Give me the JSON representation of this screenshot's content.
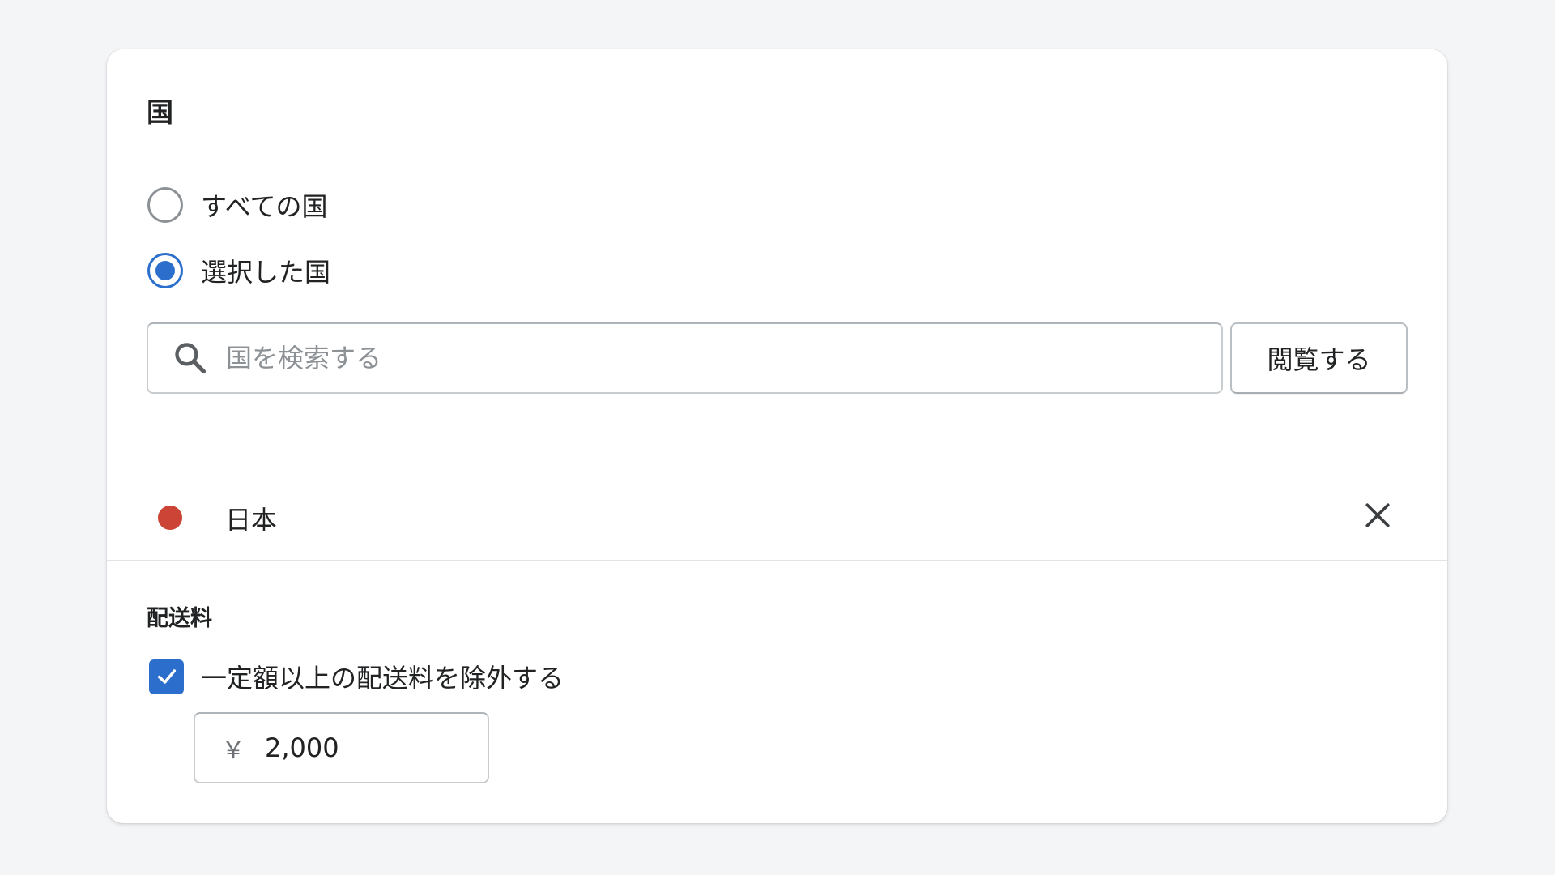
{
  "countries_section": {
    "title": "国",
    "radio_all": {
      "label": "すべての国",
      "checked": false
    },
    "radio_selected": {
      "label": "選択した国",
      "checked": true
    },
    "search": {
      "placeholder": "国を検索する",
      "value": ""
    },
    "browse_label": "閲覧する",
    "selected_countries": [
      {
        "name": "日本",
        "dot_color": "#cc4436"
      }
    ]
  },
  "shipping_section": {
    "title": "配送料",
    "exclude_checkbox": {
      "label": "一定額以上の配送料を除外する",
      "checked": true
    },
    "amount": {
      "prefix": "￥",
      "value": "2,000"
    }
  },
  "colors": {
    "accent": "#2c6ecb",
    "background": "#f4f5f7"
  }
}
